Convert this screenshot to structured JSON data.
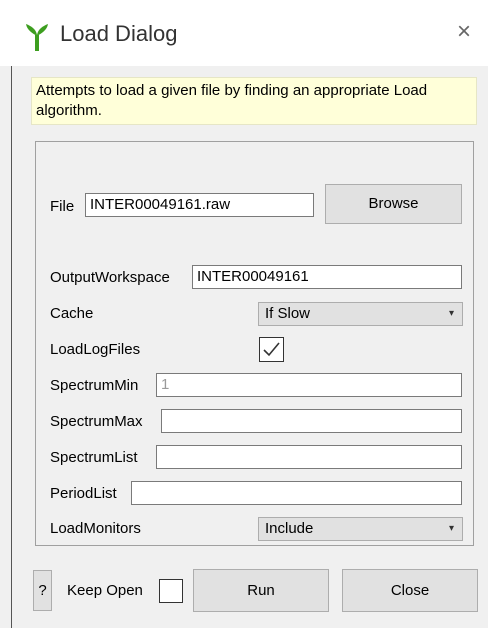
{
  "window": {
    "title": "Load Dialog",
    "close_glyph": "×",
    "icon": "mantid-icon",
    "accent_color": "#3d9e1f"
  },
  "info_text": "Attempts to load a given file by finding an appropriate Load algorithm.",
  "fields": {
    "file": {
      "label": "File",
      "value": "INTER00049161.raw",
      "browse_label": "Browse"
    },
    "output_workspace": {
      "label": "OutputWorkspace",
      "value": "INTER00049161"
    },
    "cache": {
      "label": "Cache",
      "value": "If Slow",
      "arrow": "▾"
    },
    "load_log_files": {
      "label": "LoadLogFiles",
      "checked": true
    },
    "spectrum_min": {
      "label": "SpectrumMin",
      "placeholder": "1"
    },
    "spectrum_max": {
      "label": "SpectrumMax",
      "value": ""
    },
    "spectrum_list": {
      "label": "SpectrumList",
      "value": ""
    },
    "period_list": {
      "label": "PeriodList",
      "value": ""
    },
    "load_monitors": {
      "label": "LoadMonitors",
      "value": "Include",
      "arrow": "▾"
    }
  },
  "footer": {
    "help_label": "?",
    "keep_open_label": "Keep Open",
    "keep_open_checked": false,
    "run_label": "Run",
    "close_label": "Close"
  }
}
